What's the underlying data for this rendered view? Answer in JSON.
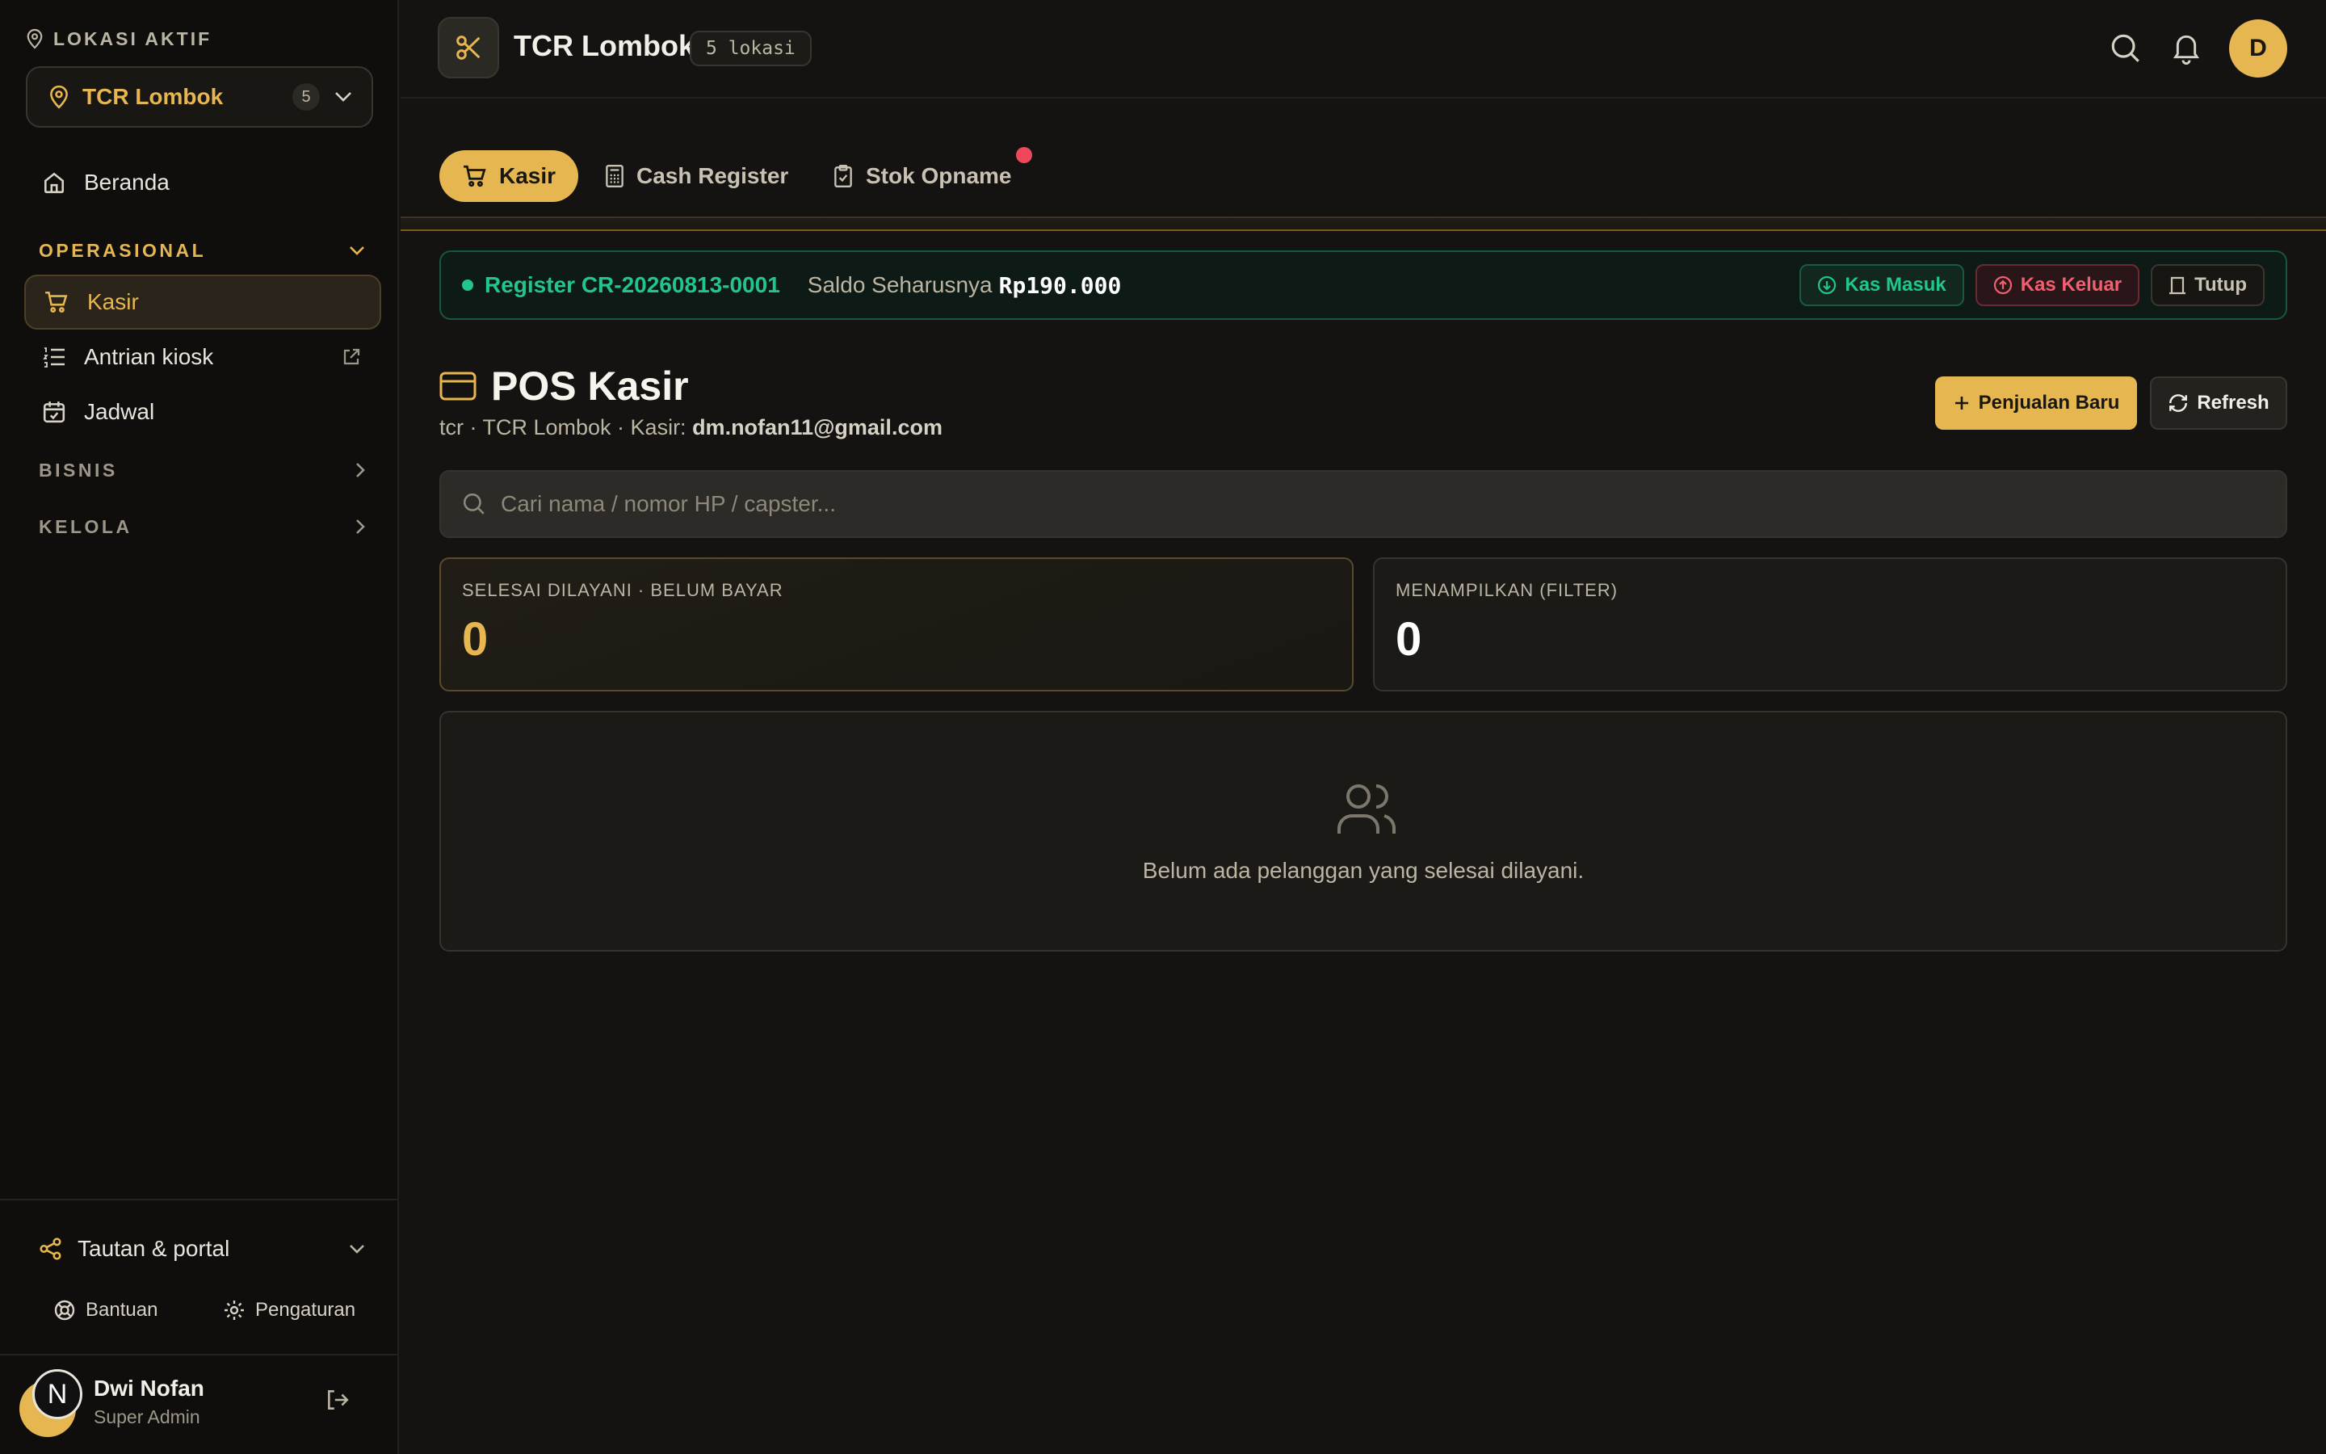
{
  "sidebar": {
    "location_heading": "LOKASI AKTIF",
    "location_name": "TCR Lombok",
    "location_count": "5",
    "home": "Beranda",
    "sections": {
      "operasional": "OPERASIONAL",
      "bisnis": "BISNIS",
      "kelola": "KELOLA"
    },
    "operasional_items": [
      {
        "label": "Kasir"
      },
      {
        "label": "Antrian kiosk"
      },
      {
        "label": "Jadwal"
      }
    ],
    "links_toggle": "Tautan & portal",
    "help": "Bantuan",
    "settings": "Pengaturan",
    "user": {
      "initial": "N",
      "name": "Dwi Nofan",
      "role": "Super Admin"
    }
  },
  "topbar": {
    "title": "TCR Lombok",
    "locations_badge": "5 lokasi",
    "avatar_initial": "D"
  },
  "tabs": [
    {
      "label": "Kasir",
      "icon": "cart-icon"
    },
    {
      "label": "Cash Register",
      "icon": "calculator-icon"
    },
    {
      "label": "Stok Opname",
      "icon": "clipboard-check-icon"
    }
  ],
  "register": {
    "id": "Register CR-20260813-0001",
    "balance_label": "Saldo Seharusnya",
    "balance_value": "Rp190.000",
    "cash_in": "Kas Masuk",
    "cash_out": "Kas Keluar",
    "close": "Tutup"
  },
  "page": {
    "title": "POS Kasir",
    "subtitle_prefix": "tcr · TCR Lombok · Kasir: ",
    "cashier_email": "dm.nofan11@gmail.com",
    "new_sale": "Penjualan Baru",
    "refresh": "Refresh"
  },
  "search": {
    "placeholder": "Cari nama / nomor HP / capster..."
  },
  "stats": [
    {
      "label": "SELESAI DILAYANI · BELUM BAYAR",
      "value": "0"
    },
    {
      "label": "MENAMPILKAN (FILTER)",
      "value": "0"
    }
  ],
  "empty": {
    "message": "Belum ada pelanggan yang selesai dilayani."
  },
  "colors": {
    "accent": "#e6b651",
    "success": "#22c58b",
    "danger": "#f0606f",
    "background": "#141311",
    "sidebar": "#0f0e0c"
  }
}
